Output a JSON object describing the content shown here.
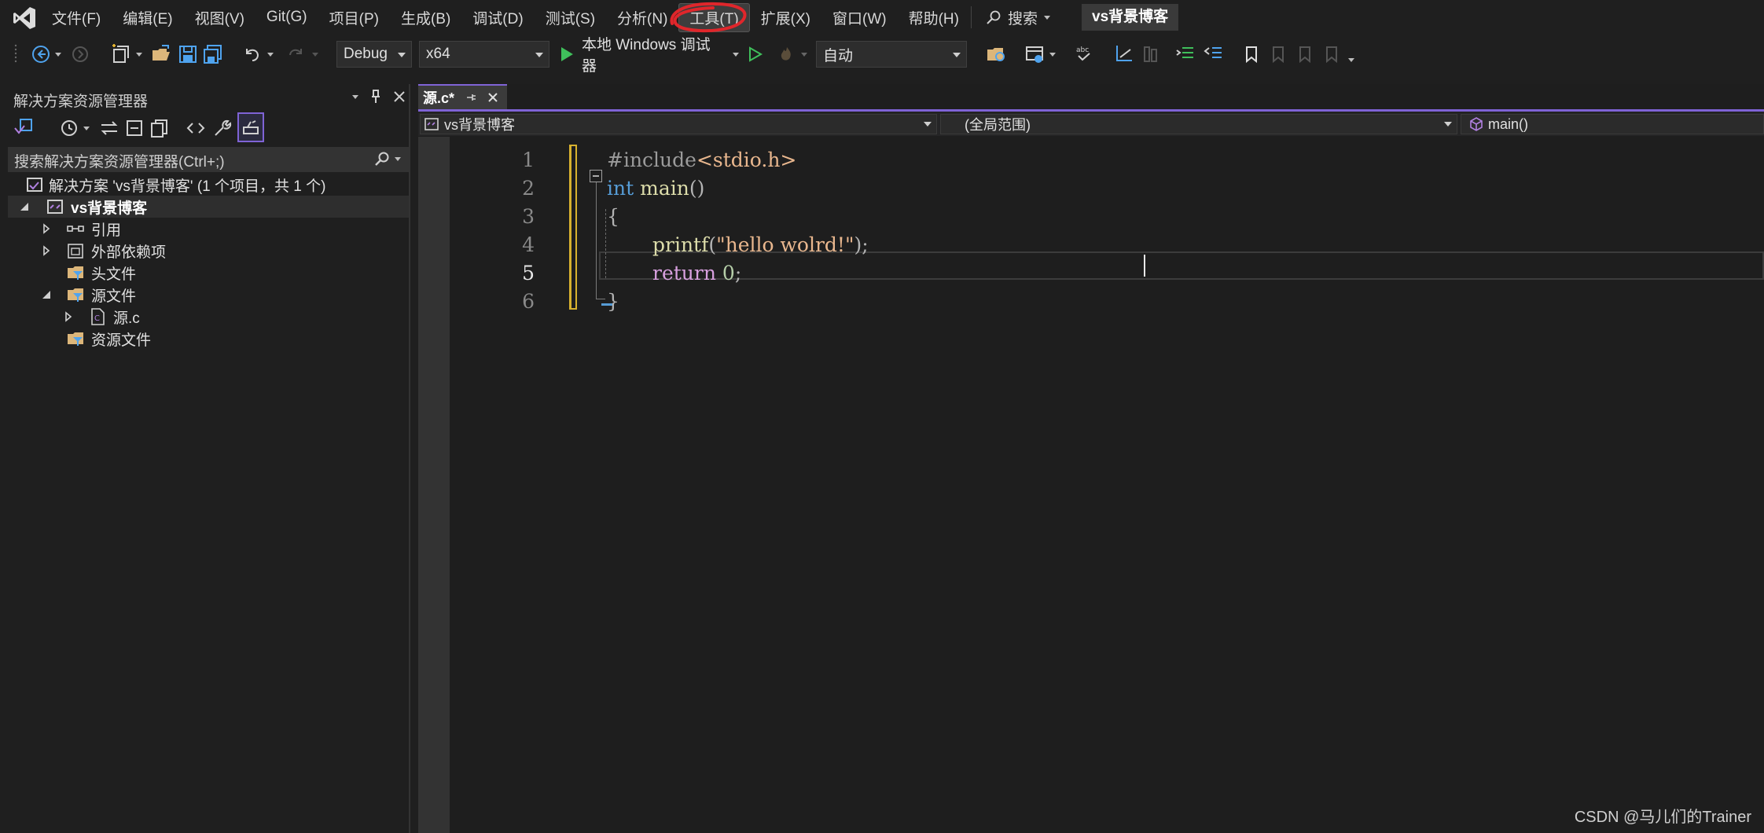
{
  "menu": {
    "items": [
      "文件(F)",
      "编辑(E)",
      "视图(V)",
      "Git(G)",
      "项目(P)",
      "生成(B)",
      "调试(D)",
      "测试(S)",
      "分析(N)",
      "工具(T)",
      "扩展(X)",
      "窗口(W)",
      "帮助(H)"
    ],
    "active_index": 9,
    "search_label": "搜索",
    "solution_badge": "vs背景博客"
  },
  "toolbar": {
    "config": "Debug",
    "platform": "x64",
    "run_label": "本地 Windows 调试器",
    "auto": "自动"
  },
  "solution_explorer": {
    "title": "解决方案资源管理器",
    "search_placeholder": "搜索解决方案资源管理器(Ctrl+;)",
    "tree": [
      {
        "label": "解决方案 'vs背景博客' (1 个项目，共 1 个)"
      },
      {
        "label": "vs背景博客"
      },
      {
        "label": "引用"
      },
      {
        "label": "外部依赖项"
      },
      {
        "label": "头文件"
      },
      {
        "label": "源文件"
      },
      {
        "label": "源.c"
      },
      {
        "label": "资源文件"
      }
    ]
  },
  "editor": {
    "tab_label": "源.c*",
    "nav_project": "vs背景博客",
    "nav_scope": "(全局范围)",
    "nav_member": "main()",
    "line_numbers": [
      "1",
      "2",
      "3",
      "4",
      "5",
      "6"
    ],
    "current_line": 5,
    "code": {
      "l1_pre": "#include",
      "l1_hdr": "<stdio.h>",
      "l2_kw": "int",
      "l2_fn": "main",
      "l2_punc": "()",
      "l3": "{",
      "l4_fn": "printf",
      "l4_open": "(",
      "l4_str": "\"hello wolrd!\"",
      "l4_close": ");",
      "l5_kw": "return",
      "l5_num": "0",
      "l5_semi": ";",
      "l6": "}"
    }
  },
  "watermark": "CSDN @马儿们的Trainer",
  "colors": {
    "accent": "#7f63d6",
    "annotation_red": "#e0262b",
    "keyword": "#569cd6",
    "string": "#e9b78e",
    "function": "#dcdcaa",
    "control": "#d8a0df",
    "number": "#b5cea8"
  }
}
